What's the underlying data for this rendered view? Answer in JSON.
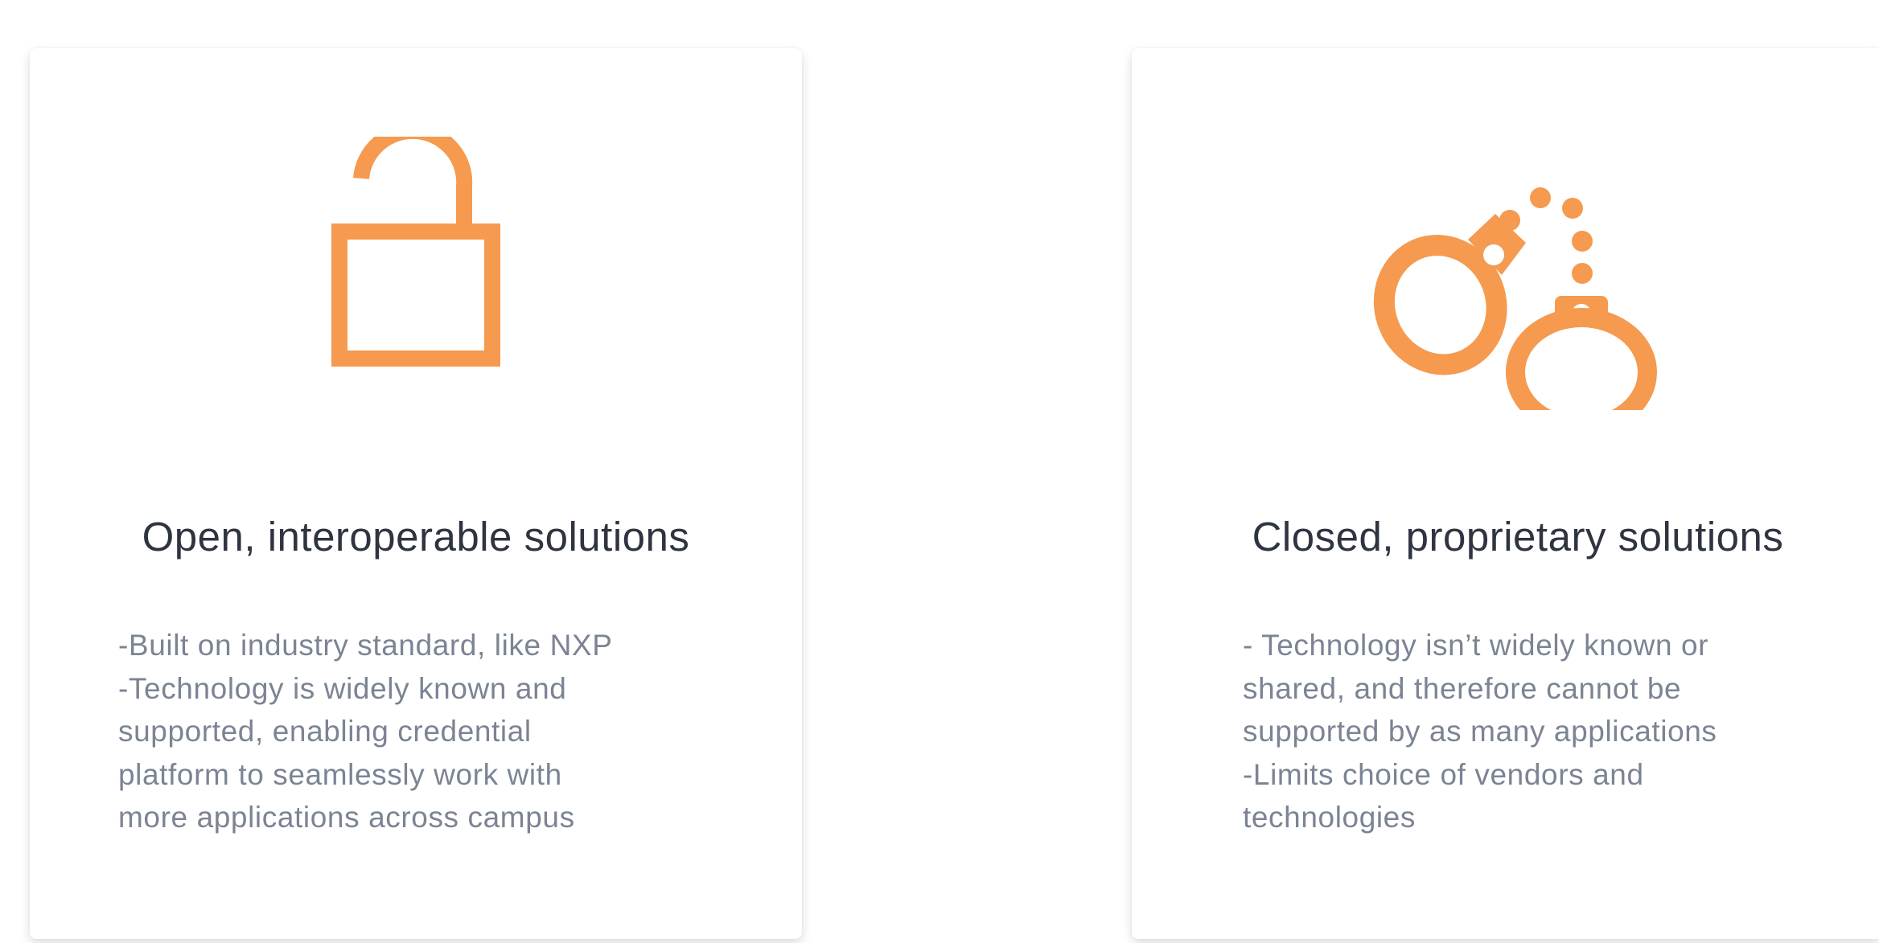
{
  "cards": [
    {
      "title": "Open, interoperable solutions",
      "description": "-Built on industry standard, like NXP\n-Technology is widely known and\nsupported, enabling credential\nplatform to seamlessly work with\nmore applications across campus",
      "icon": "unlocked-padlock-icon"
    },
    {
      "title": "Closed, proprietary solutions",
      "description": "- Technology isn’t widely known or\nshared, and therefore cannot be\nsupported by as many applications\n-Limits choice of vendors and\ntechnologies",
      "icon": "handcuffs-icon"
    }
  ],
  "colors": {
    "accent": "#f59a4f",
    "title": "#2e3440",
    "body_text": "#7b8494"
  }
}
